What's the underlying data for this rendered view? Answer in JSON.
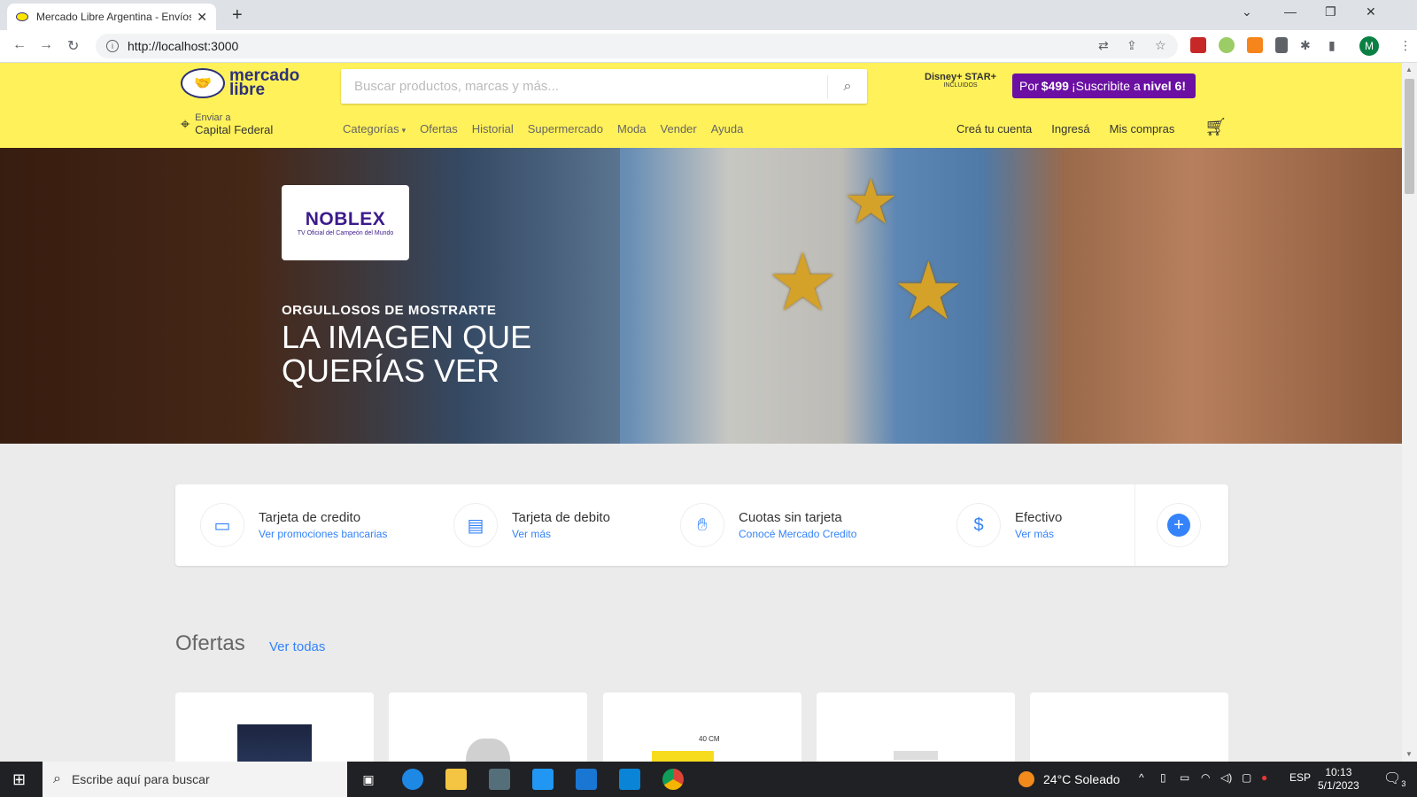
{
  "browser": {
    "tab_title": "Mercado Libre Argentina - Envíos",
    "new_tab": "+",
    "url": "http://localhost:3000",
    "avatar_initial": "M"
  },
  "header": {
    "logo_text": "mercado libre",
    "search_placeholder": "Buscar productos, marcas y más...",
    "disney_text": "Disney+ STAR+",
    "disney_sub": "INCLUIDOS",
    "promo": {
      "pre": "Por",
      "price": "$499",
      "mid": "¡Suscribite a",
      "level": "nivel 6!"
    },
    "location_line1": "Enviar a",
    "location_line2": "Capital Federal",
    "nav": [
      "Categorías",
      "Ofertas",
      "Historial",
      "Supermercado",
      "Moda",
      "Vender",
      "Ayuda"
    ],
    "user_nav": [
      "Creá tu cuenta",
      "Ingresá",
      "Mis compras"
    ]
  },
  "hero": {
    "brand": "NOBLEX",
    "brand_tagline": "TV Oficial del Campeón del Mundo",
    "kicker": "ORGULLOSOS DE MOSTRARTE",
    "headline": "LA IMAGEN QUE QUERÍAS VER"
  },
  "payments": [
    {
      "title": "Tarjeta de credito",
      "link": "Ver promociones bancarias",
      "icon": "credit-card-icon"
    },
    {
      "title": "Tarjeta de debito",
      "link": "Ver más",
      "icon": "debit-card-icon"
    },
    {
      "title": "Cuotas sin tarjeta",
      "link": "Conocé Mercado Credito",
      "icon": "hand-coin-icon"
    },
    {
      "title": "Efectivo",
      "link": "Ver más",
      "icon": "cash-icon"
    }
  ],
  "offers": {
    "title": "Ofertas",
    "link": "Ver todas",
    "card_label": "40 CM"
  },
  "taskbar": {
    "search_placeholder": "Escribe aquí para buscar",
    "weather": "24°C  Soleado",
    "lang": "ESP",
    "time": "10:13",
    "date": "5/1/2023",
    "notif_count": "3"
  }
}
